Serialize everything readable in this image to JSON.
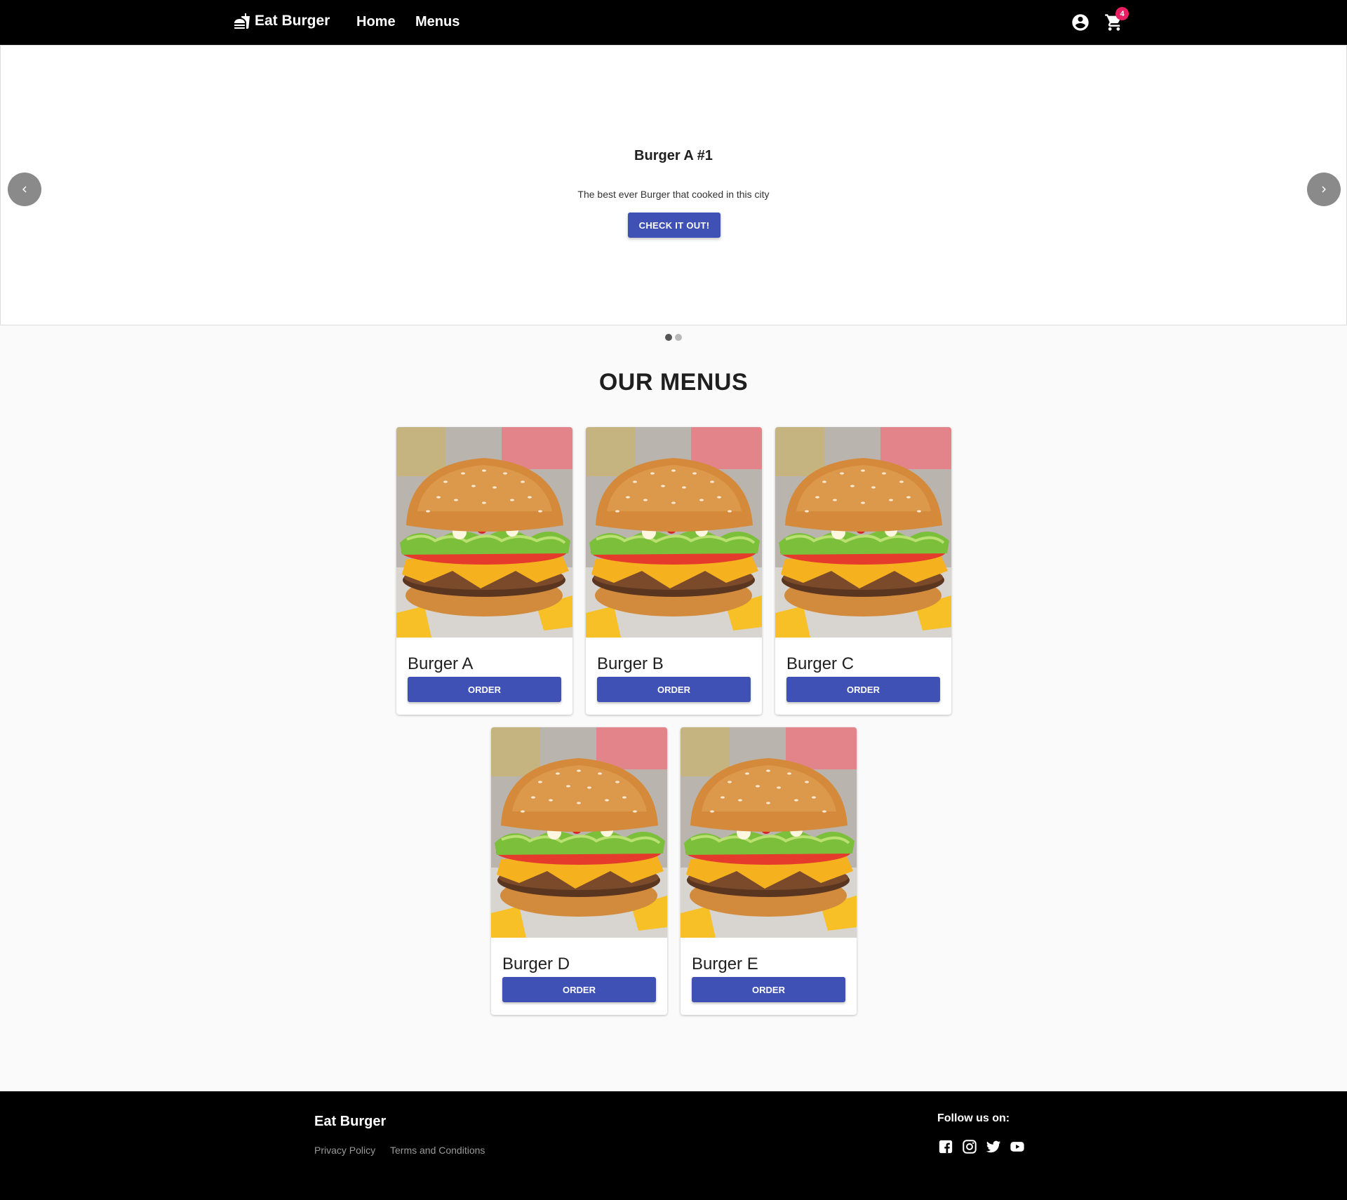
{
  "navbar": {
    "brand": "Eat Burger",
    "links": [
      "Home",
      "Menus"
    ],
    "cart_count": "4"
  },
  "carousel": {
    "title": "Burger A #1",
    "description": "The best ever Burger that cooked in this city",
    "button_label": "CHECK IT OUT!",
    "slides_total": 2,
    "active_slide": 1
  },
  "menus": {
    "title": "OUR MENUS",
    "items": [
      {
        "name": "Burger A",
        "button": "ORDER"
      },
      {
        "name": "Burger B",
        "button": "ORDER"
      },
      {
        "name": "Burger C",
        "button": "ORDER"
      },
      {
        "name": "Burger D",
        "button": "ORDER"
      },
      {
        "name": "Burger E",
        "button": "ORDER"
      }
    ]
  },
  "footer": {
    "brand": "Eat Burger",
    "links": [
      "Privacy Policy",
      "Terms and Conditions"
    ],
    "follow_label": "Follow us on:",
    "social": [
      "facebook-icon",
      "instagram-icon",
      "twitter-icon",
      "youtube-icon"
    ]
  },
  "colors": {
    "primary": "#3f51b5",
    "badge": "#e91e63",
    "navbar": "#000000",
    "background": "#fafafa"
  }
}
